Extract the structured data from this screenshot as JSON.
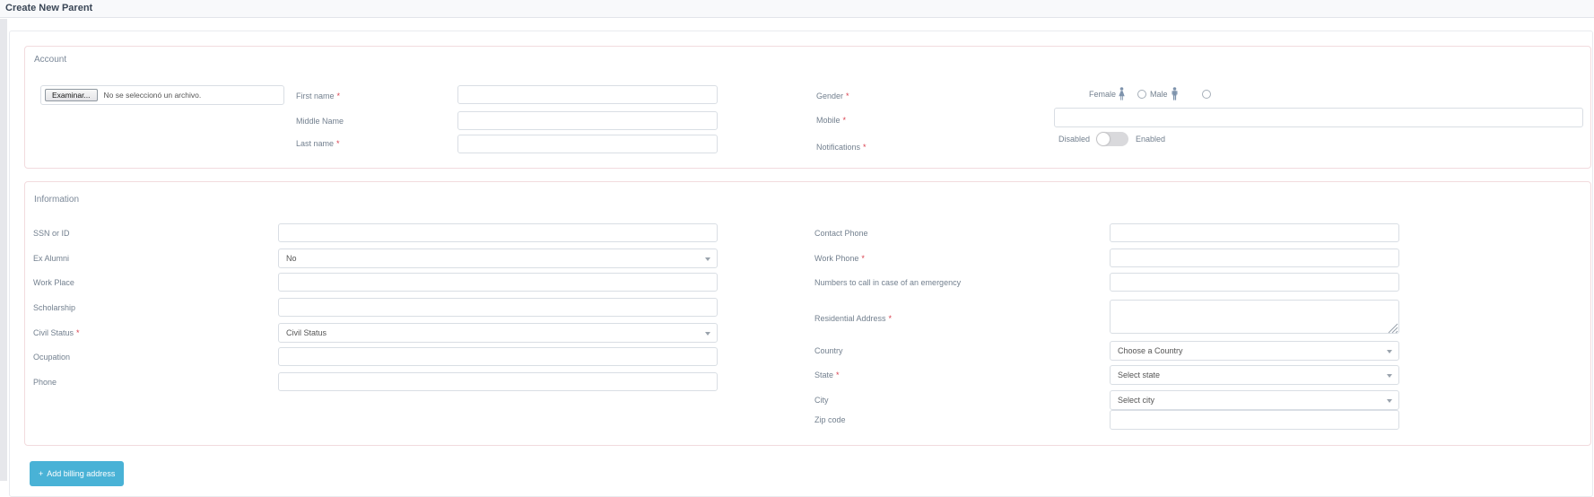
{
  "header": {
    "title": "Create New Parent"
  },
  "ui": {
    "required_marker": "*"
  },
  "account": {
    "heading": "Account",
    "file_input": {
      "browse_label": "Examinar...",
      "status_text": "No se seleccionó un archivo."
    },
    "first_name": {
      "label": "First name",
      "value": ""
    },
    "middle_name": {
      "label": "Middle Name",
      "value": ""
    },
    "last_name": {
      "label": "Last name",
      "value": ""
    },
    "gender": {
      "label": "Gender",
      "female_label": "Female",
      "male_label": "Male",
      "selected": ""
    },
    "mobile": {
      "label": "Mobile",
      "value": ""
    },
    "notifications": {
      "label": "Notifications",
      "disabled_label": "Disabled",
      "enabled_label": "Enabled",
      "state": "Disabled"
    }
  },
  "information": {
    "heading": "Information",
    "ssn": {
      "label": "SSN or ID",
      "value": ""
    },
    "ex_alumni": {
      "label": "Ex Alumni",
      "value": "No"
    },
    "work_place": {
      "label": "Work Place",
      "value": ""
    },
    "scholarship": {
      "label": "Scholarship",
      "value": ""
    },
    "civil_status": {
      "label": "Civil Status",
      "value": "Civil Status"
    },
    "ocupation": {
      "label": "Ocupation",
      "value": ""
    },
    "phone": {
      "label": "Phone",
      "value": ""
    },
    "contact_phone": {
      "label": "Contact Phone",
      "value": ""
    },
    "work_phone": {
      "label": "Work Phone",
      "value": ""
    },
    "emergency_numbers": {
      "label": "Numbers to call in case of an emergency",
      "value": ""
    },
    "residential_address": {
      "label": "Residential Address",
      "value": ""
    },
    "country": {
      "label": "Country",
      "value": "Choose a Country"
    },
    "state": {
      "label": "State",
      "value": "Select state"
    },
    "city": {
      "label": "City",
      "value": "Select city"
    },
    "zip": {
      "label": "Zip code",
      "value": ""
    }
  },
  "actions": {
    "plus": "+",
    "add_billing_address": "Add billing address"
  },
  "colors": {
    "accent": "#49b2d6",
    "required": "#d9404f",
    "panel_border": "#f2dbde",
    "icon_blue": "#7e93ac"
  }
}
